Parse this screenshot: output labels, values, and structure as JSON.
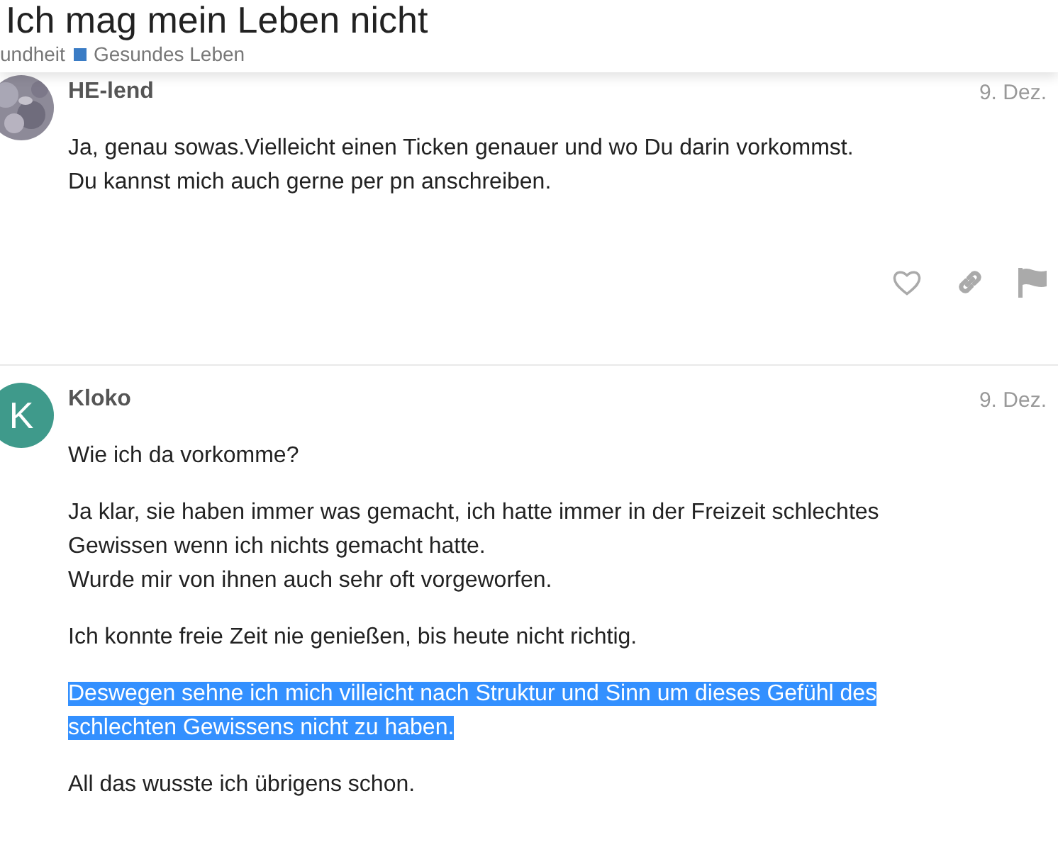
{
  "topic": {
    "title": "Ich mag mein Leben nicht",
    "breadcrumbs": [
      {
        "label": "undheit"
      },
      {
        "label": "Gesundes Leben",
        "color": "#3a7cc5"
      }
    ]
  },
  "posts": [
    {
      "author": "HE-lend",
      "date": "9. Dez.",
      "avatar": {
        "kind": "picture"
      },
      "actions_visible": true,
      "paragraphs": [
        {
          "text": "Ja, genau sowas.Vielleicht einen Ticken genauer und wo Du darin vorkommst.\nDu kannst mich auch gerne per pn anschreiben.",
          "selected": false
        }
      ]
    },
    {
      "author": "Kloko",
      "date": "9. Dez.",
      "avatar": {
        "kind": "letter",
        "letter": "K",
        "color": "#3f9a8b"
      },
      "actions_visible": false,
      "paragraphs": [
        {
          "text": "Wie ich da vorkomme?",
          "selected": false
        },
        {
          "text": "Ja klar, sie haben immer was gemacht, ich hatte immer in der Freizeit schlechtes\nGewissen wenn ich nichts gemacht hatte.\nWurde mir von ihnen auch sehr oft vorgeworfen.",
          "selected": false
        },
        {
          "text": "Ich konnte freie Zeit nie genießen, bis heute nicht richtig.",
          "selected": false
        },
        {
          "text": "Deswegen sehne ich mich villeicht nach Struktur und Sinn um dieses Gefühl des\nschlechten Gewissens nicht zu haben.",
          "selected": true
        },
        {
          "text": "All das wusste ich übrigens schon.",
          "selected": false
        }
      ]
    }
  ]
}
